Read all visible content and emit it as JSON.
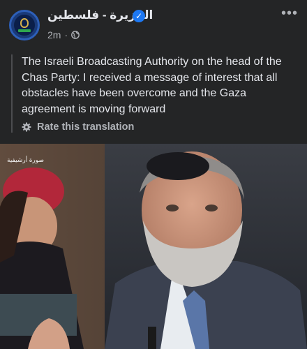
{
  "post": {
    "page_name": "الجزيرة - فلسطين",
    "time": "2m",
    "translation": "The Israeli Broadcasting Authority on the head of the Chas Party: I received a message of interest that all obstacles have been overcome and the Gaza agreement is moving forward",
    "rate_label": "Rate this translation",
    "photo_watermark": "صورة أرشيفية",
    "more_label": "•••"
  },
  "icons": {
    "verified": "verified-badge-icon",
    "privacy": "globe-icon",
    "rate": "gear-icon",
    "more": "more-options-icon"
  },
  "colors": {
    "background": "#242526",
    "verified": "#1d78f2",
    "secondary_text": "#b0b3b8"
  }
}
